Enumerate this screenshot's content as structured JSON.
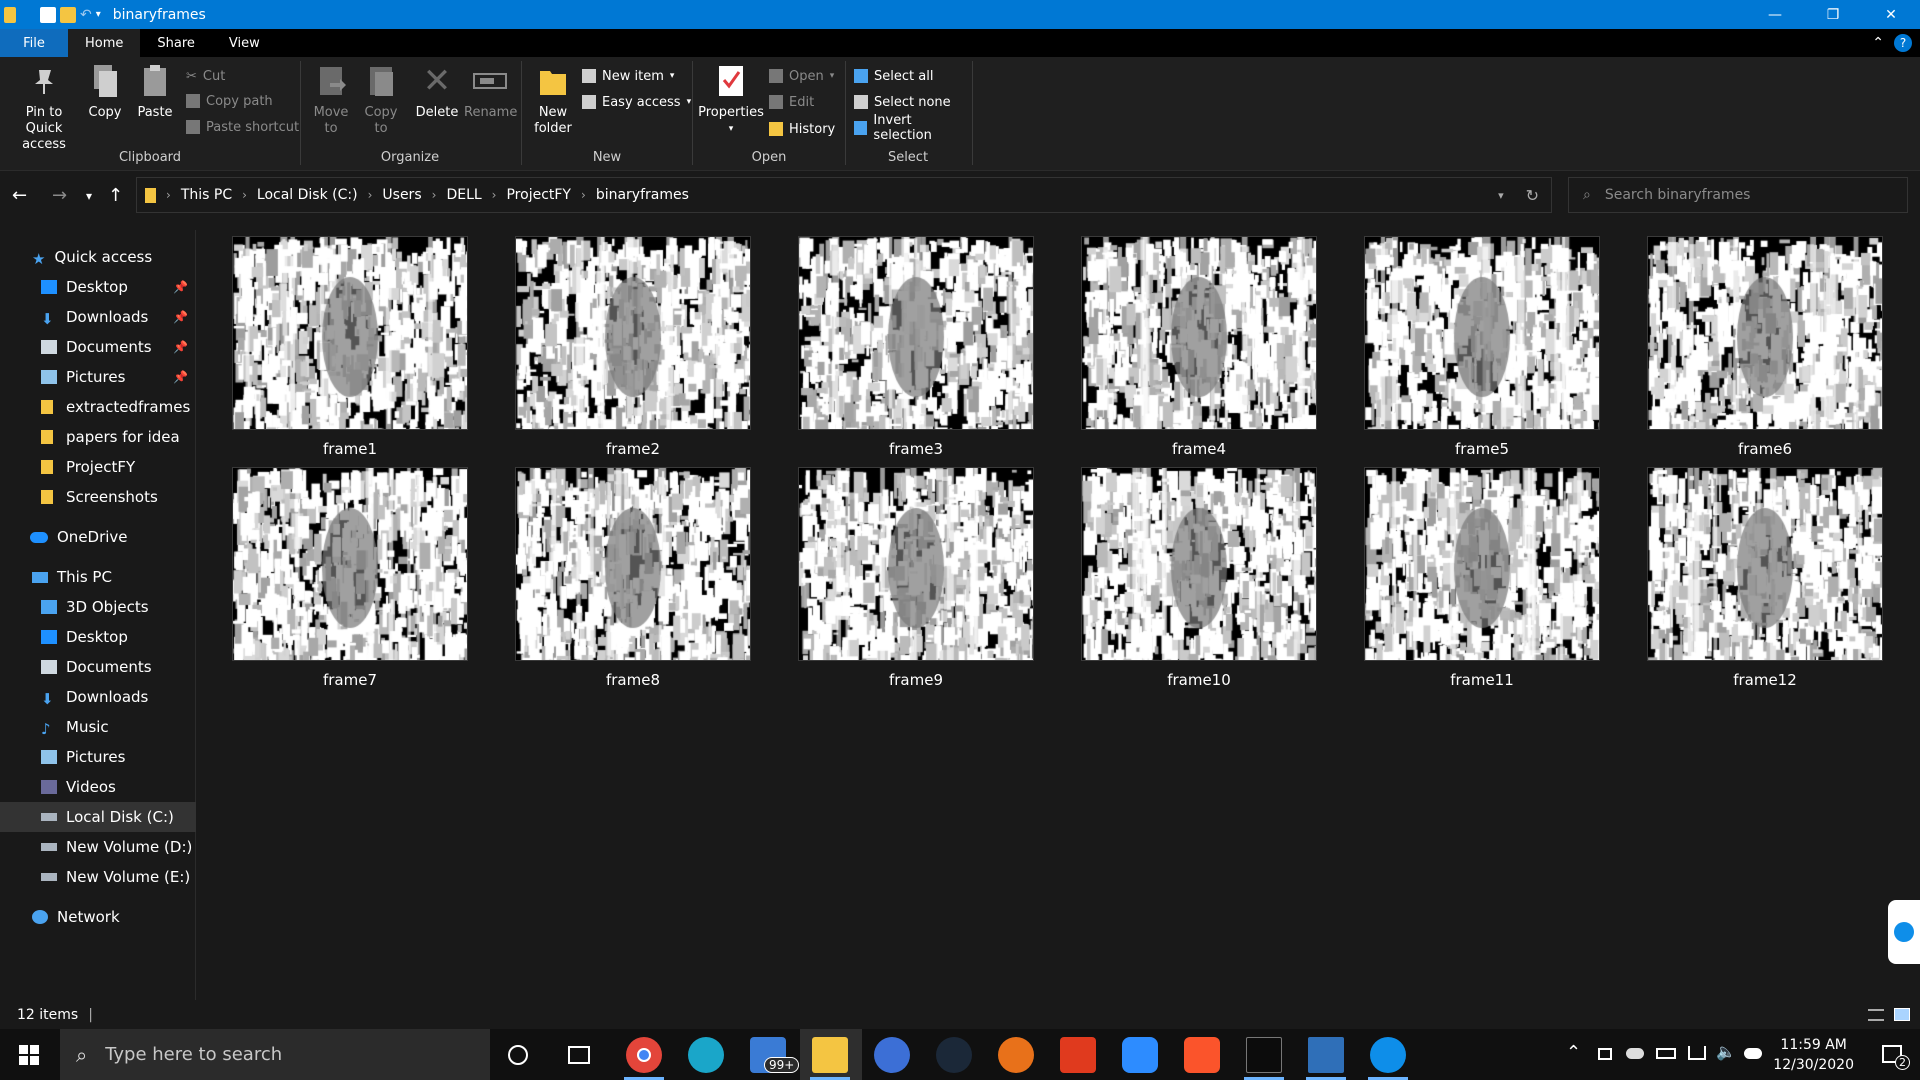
{
  "window": {
    "title": "binaryframes",
    "min_glyph": "—",
    "max_glyph": "❐",
    "close_glyph": "✕"
  },
  "tabs": [
    {
      "label": "File"
    },
    {
      "label": "Home"
    },
    {
      "label": "Share"
    },
    {
      "label": "View"
    }
  ],
  "ribbon": {
    "clipboard": {
      "pin": "Pin to Quick",
      "pin2": "access",
      "copy": "Copy",
      "paste": "Paste",
      "cut": "Cut",
      "copy_path": "Copy path",
      "paste_shortcut": "Paste shortcut",
      "label": "Clipboard"
    },
    "organize": {
      "move": "Move",
      "move2": "to",
      "copy": "Copy",
      "copy2": "to",
      "delete": "Delete",
      "rename": "Rename",
      "label": "Organize"
    },
    "new": {
      "new_folder": "New",
      "new_folder2": "folder",
      "new_item": "New item",
      "easy_access": "Easy access",
      "label": "New"
    },
    "open": {
      "properties": "Properties",
      "open": "Open",
      "edit": "Edit",
      "history": "History",
      "label": "Open"
    },
    "select": {
      "all": "Select all",
      "none": "Select none",
      "invert": "Invert selection",
      "label": "Select"
    }
  },
  "address": {
    "crumbs": [
      "This PC",
      "Local Disk (C:)",
      "Users",
      "DELL",
      "ProjectFY",
      "binaryframes"
    ]
  },
  "search": {
    "placeholder": "Search binaryframes"
  },
  "nav": {
    "quick_access": "Quick access",
    "quick": [
      "Desktop",
      "Downloads",
      "Documents",
      "Pictures",
      "extractedframes",
      "papers for idea",
      "ProjectFY",
      "Screenshots"
    ],
    "onedrive": "OneDrive",
    "this_pc": "This PC",
    "pc": [
      "3D Objects",
      "Desktop",
      "Documents",
      "Downloads",
      "Music",
      "Pictures",
      "Videos",
      "Local Disk (C:)",
      "New Volume (D:)",
      "New Volume (E:)"
    ],
    "network": "Network"
  },
  "files": [
    {
      "name": "frame1"
    },
    {
      "name": "frame2"
    },
    {
      "name": "frame3"
    },
    {
      "name": "frame4"
    },
    {
      "name": "frame5"
    },
    {
      "name": "frame6"
    },
    {
      "name": "frame7"
    },
    {
      "name": "frame8"
    },
    {
      "name": "frame9"
    },
    {
      "name": "frame10"
    },
    {
      "name": "frame11"
    },
    {
      "name": "frame12"
    }
  ],
  "status": {
    "items": "12 items"
  },
  "taskbar": {
    "search_placeholder": "Type here to search",
    "mail_badge": "99+",
    "time": "11:59 AM",
    "date": "12/30/2020",
    "notif": "2"
  },
  "colors": {
    "accent": "#0078d4",
    "folder": "#f4c542",
    "bg": "#191919"
  }
}
